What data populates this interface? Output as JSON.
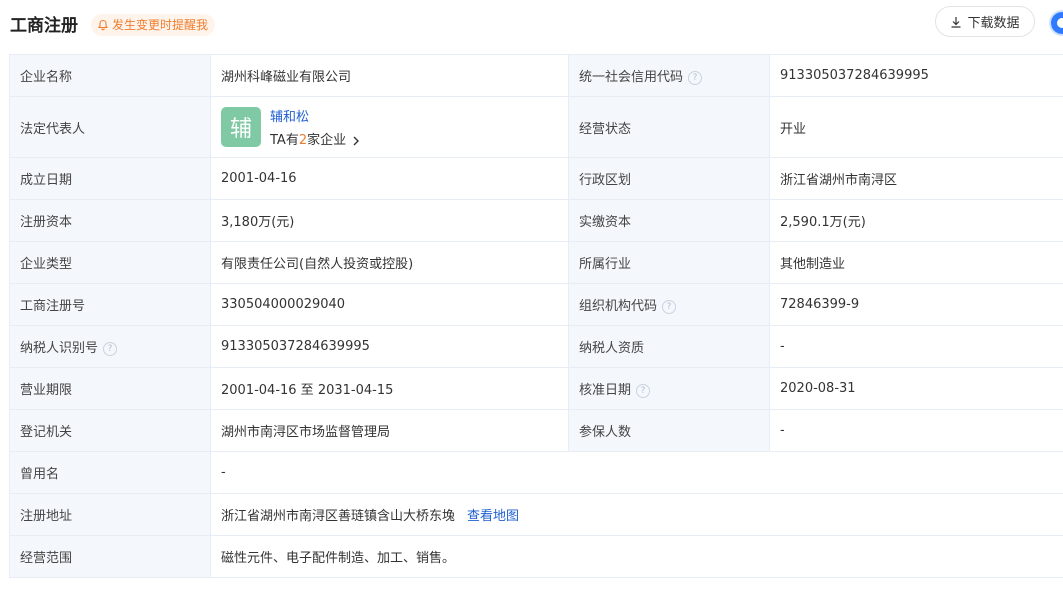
{
  "header": {
    "title": "工商注册",
    "remind": "发生变更时提醒我",
    "download": "下载数据"
  },
  "info": {
    "company_name_label": "企业名称",
    "company_name": "湖州科峰磁业有限公司",
    "credit_code_label": "统一社会信用代码",
    "credit_code": "913305037284639995",
    "legal_rep_label": "法定代表人",
    "legal_rep_avatar": "辅",
    "legal_rep_name": "辅和松",
    "legal_rep_prefix": "TA有",
    "legal_rep_count": "2",
    "legal_rep_suffix": "家企业",
    "status_label": "经营状态",
    "status": "开业",
    "founded_label": "成立日期",
    "founded": "2001-04-16",
    "region_label": "行政区划",
    "region": "浙江省湖州市南浔区",
    "reg_capital_label": "注册资本",
    "reg_capital": "3,180万(元)",
    "paid_capital_label": "实缴资本",
    "paid_capital": "2,590.1万(元)",
    "type_label": "企业类型",
    "type": "有限责任公司(自然人投资或控股)",
    "industry_label": "所属行业",
    "industry": "其他制造业",
    "reg_no_label": "工商注册号",
    "reg_no": "330504000029040",
    "org_code_label": "组织机构代码",
    "org_code": "72846399-9",
    "taxpayer_id_label": "纳税人识别号",
    "taxpayer_id": "91330503728463999​5",
    "taxpayer_qual_label": "纳税人资质",
    "taxpayer_qual": "-",
    "term_label": "营业期限",
    "term": "2001-04-16 至 2031-04-15",
    "approve_label": "核准日期",
    "approve": "2020-08-31",
    "authority_label": "登记机关",
    "authority": "湖州市南浔区市场监督管理局",
    "insured_label": "参保人数",
    "insured": "-",
    "former_name_label": "曾用名",
    "former_name": "-",
    "address_label": "注册地址",
    "address": "浙江省湖州市南浔区善琏镇含山大桥东堍",
    "map_link": "查看地图",
    "scope_label": "经营范围",
    "scope": "磁性元件、电子配件制造、加工、销售。"
  },
  "help_glyph": "?",
  "colors": {
    "link": "#1f5fd1",
    "accent": "#f07d2d",
    "label_bg": "#f4f7fb",
    "avatar": "#7fcaa5"
  }
}
